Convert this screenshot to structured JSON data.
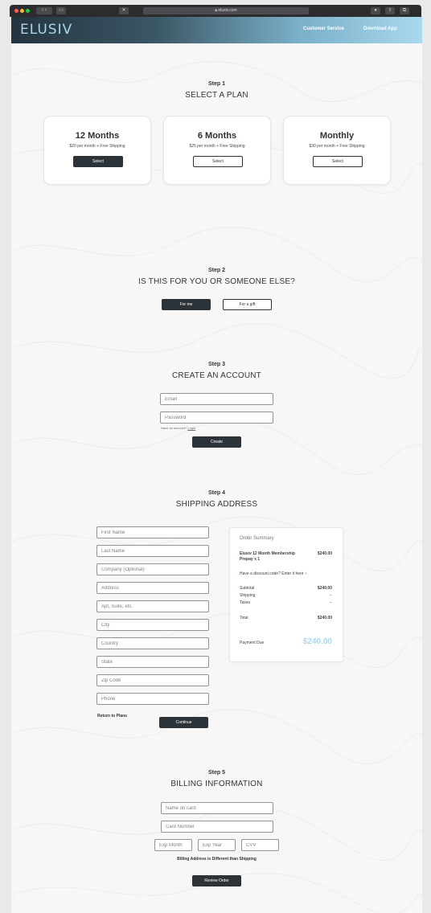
{
  "browser": {
    "url": "elusiv.com",
    "colors": {
      "close": "#ff5f57",
      "minimize": "#febc2e",
      "maximize": "#28c840"
    }
  },
  "header": {
    "logo": "ELUSIV",
    "nav": {
      "customer_service": "Customer Service",
      "download_app": "Download App"
    }
  },
  "step1": {
    "label": "Step 1",
    "title": "SELECT A PLAN",
    "plans": [
      {
        "title": "12 Months",
        "sub": "$20 per month + Free Shipping",
        "button": "Select"
      },
      {
        "title": "6 Months",
        "sub": "$25 per month + Free Shipping",
        "button": "Select"
      },
      {
        "title": "Monthly",
        "sub": "$30 per month + Free Shipping",
        "button": "Select"
      }
    ]
  },
  "step2": {
    "label": "Step 2",
    "title": "IS THIS FOR YOU OR SOMEONE ELSE?",
    "for_me": "For me",
    "for_gift": "For a gift"
  },
  "step3": {
    "label": "Step 3",
    "title": "CREATE AN ACCOUNT",
    "email_placeholder": "Email",
    "password_placeholder": "Password",
    "have_account": "Have an account?",
    "login": "Login",
    "create": "Create"
  },
  "step4": {
    "label": "Step 4",
    "title": "SHIPPING ADDRESS",
    "fields": {
      "first_name": "First Name",
      "last_name": "Last Name",
      "company": "Company (Optional)",
      "address": "Address",
      "apt": "Apt, Suite, etc.",
      "city": "City",
      "country": "Country",
      "state": "State",
      "zip": "Zip Code",
      "phone": "Phone"
    },
    "return_link": "Return to Plans",
    "continue": "Continue"
  },
  "summary": {
    "title": "Order Summary",
    "item_line1": "Elusiv 12 Month Membership",
    "item_line2": "Prepay x 1",
    "item_price": "$240.00",
    "discount": "Have a discount code? Enter it here",
    "discount_arrow": ">",
    "subtotal_label": "Subtotal",
    "subtotal_value": "$240.00",
    "shipping_label": "Shipping",
    "shipping_value": "--",
    "taxes_label": "Taxes",
    "taxes_value": "--",
    "total_label": "Total",
    "total_value": "$240.00",
    "payment_label": "Payment Due",
    "payment_value": "$240.00",
    "accent": "#a9d8f0"
  },
  "step5": {
    "label": "Step 5",
    "title": "BILLING INFORMATION",
    "name_placeholder": "Name on card",
    "card_placeholder": "Card Number",
    "exp_month_placeholder": "Exp Month",
    "exp_year_placeholder": "Exp Year",
    "cvv_placeholder": "CVV",
    "billing_note": "Billing Address is Different than Shipping",
    "review": "Review Order"
  }
}
